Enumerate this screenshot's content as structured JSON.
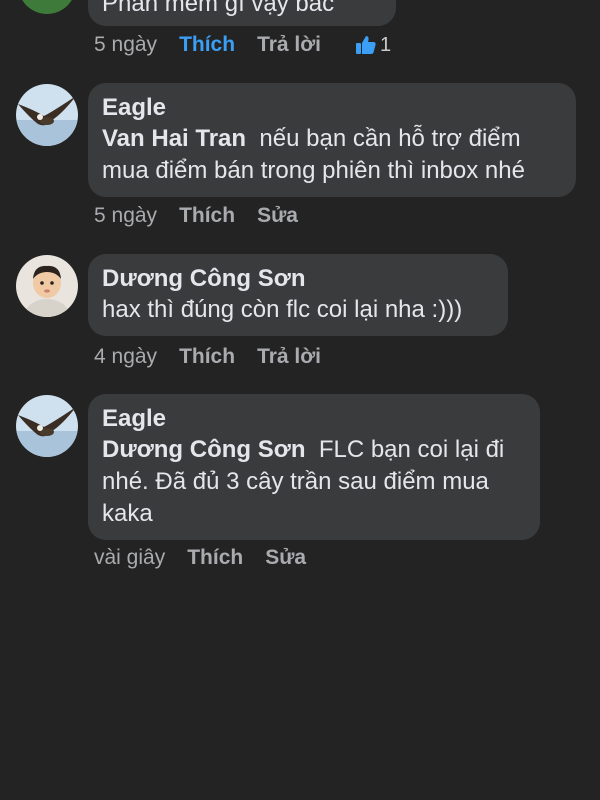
{
  "comments": [
    {
      "author": "",
      "text": "Phần mềm gì vậy bác",
      "time": "5 ngày",
      "actions": [
        "Thích",
        "Trả lời"
      ],
      "liked": true,
      "reaction_count": "1"
    },
    {
      "author": "Eagle",
      "mention": "Van Hai Tran",
      "text_line1": "nếu bạn cần hỗ trợ điểm",
      "text_line2": "mua điểm bán trong phiên thì inbox nhé",
      "time": "5 ngày",
      "actions": [
        "Thích",
        "Sửa"
      ]
    },
    {
      "author": "Dương Công Sơn",
      "text": "hax thì đúng còn flc coi lại nha :)))",
      "time": "4 ngày",
      "actions": [
        "Thích",
        "Trả lời"
      ]
    },
    {
      "author": "Eagle",
      "mention": "Dương Công Sơn",
      "text_line1": "FLC bạn coi lại đi",
      "text_line2": "nhé. Đã đủ 3 cây trần sau điểm mua",
      "text_line3": "kaka",
      "time": "vài giây",
      "actions": [
        "Thích",
        "Sửa"
      ]
    }
  ],
  "colors": {
    "background": "#232323",
    "bubble": "#3a3b3c",
    "liked": "#3b9ff5",
    "meta": "#a9abae"
  },
  "icons": {
    "reaction": "thumbs-up-icon"
  }
}
